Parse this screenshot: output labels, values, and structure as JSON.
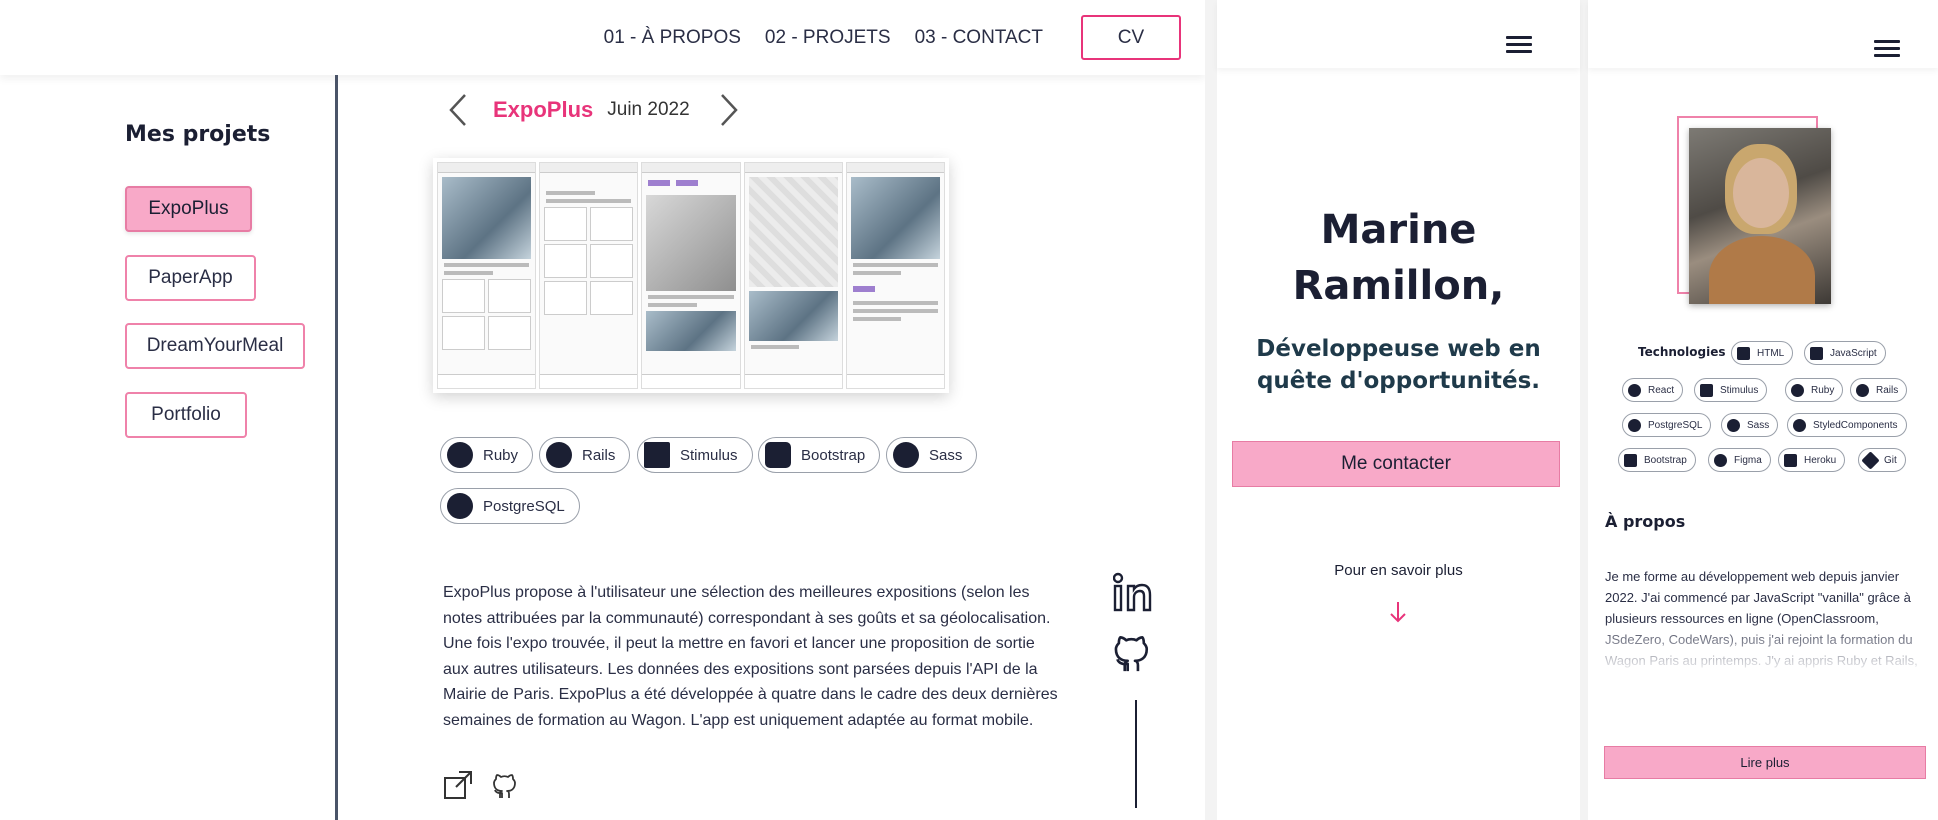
{
  "nav": {
    "links": [
      "01 - À PROPOS",
      "02 - PROJETS",
      "03 - CONTACT"
    ],
    "cv_label": "CV"
  },
  "sidebar": {
    "title": "Mes projets",
    "projects": [
      "ExpoPlus",
      "PaperApp",
      "DreamYourMeal",
      "Portfolio"
    ],
    "active": "ExpoPlus"
  },
  "project": {
    "name": "ExpoPlus",
    "date": "Juin 2022",
    "technologies": [
      "Ruby",
      "Rails",
      "Stimulus",
      "Bootstrap",
      "Sass",
      "PostgreSQL"
    ],
    "description": "ExpoPlus propose à l'utilisateur une sélection des meilleures expositions (selon les notes attribuées par la communauté) correspondant à ses goûts et sa géolocalisation. Une fois l'expo trouvée, il peut la mettre en favori et lancer une proposition de sortie aux autres utilisateurs. Les données des expositions sont parsées depuis l'API de la Mairie de Paris. ExpoPlus a été développée à quatre dans le cadre des deux dernières semaines de formation au Wagon. L'app est uniquement adaptée au format mobile."
  },
  "mobile_home": {
    "name": "Marine Ramillon,",
    "role": "Développeuse web en quête d'opportunités.",
    "contact_label": "Me contacter",
    "more_label": "Pour en savoir plus"
  },
  "mobile_about": {
    "tech_title": "Technologies",
    "techs": [
      "HTML",
      "JavaScript",
      "React",
      "Stimulus",
      "Ruby",
      "Rails",
      "PostgreSQL",
      "Sass",
      "StyledComponents",
      "Bootstrap",
      "Figma",
      "Heroku",
      "Git"
    ],
    "about_title": "À propos",
    "about_text": "Je me forme au développement web depuis janvier 2022. J'ai commencé par JavaScript \"vanilla\" grâce à plusieurs ressources en ligne (OpenClassroom, JSdeZero, CodeWars), puis j'ai rejoint la formation du Wagon Paris au printemps. J'y ai appris Ruby et Rails, la",
    "read_more_label": "Lire plus"
  },
  "colors": {
    "accent": "#e8347a",
    "pink_fill": "#f8a9c8",
    "dark": "#1b1f33"
  }
}
